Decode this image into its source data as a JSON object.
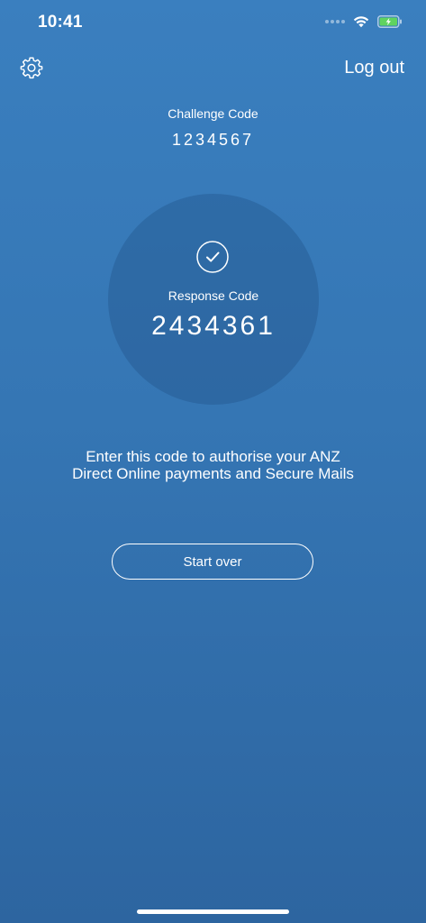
{
  "status_bar": {
    "time": "10:41",
    "icons": [
      "signal-icon",
      "wifi-icon",
      "battery-charging-icon"
    ]
  },
  "header": {
    "settings_icon": "gear-icon",
    "logout_label": "Log out"
  },
  "challenge": {
    "label": "Challenge Code",
    "value": "1234567"
  },
  "response": {
    "icon": "checkmark-icon",
    "label": "Response Code",
    "value": "2434361"
  },
  "instructions": {
    "text": "Enter this code to authorise your ANZ Direct Online payments and Secure Mails"
  },
  "actions": {
    "start_over_label": "Start over"
  },
  "colors": {
    "background_top": "#3a7fbf",
    "background_bottom": "#2d65a0",
    "foreground": "#ffffff",
    "battery_fill": "#5fd35f"
  }
}
